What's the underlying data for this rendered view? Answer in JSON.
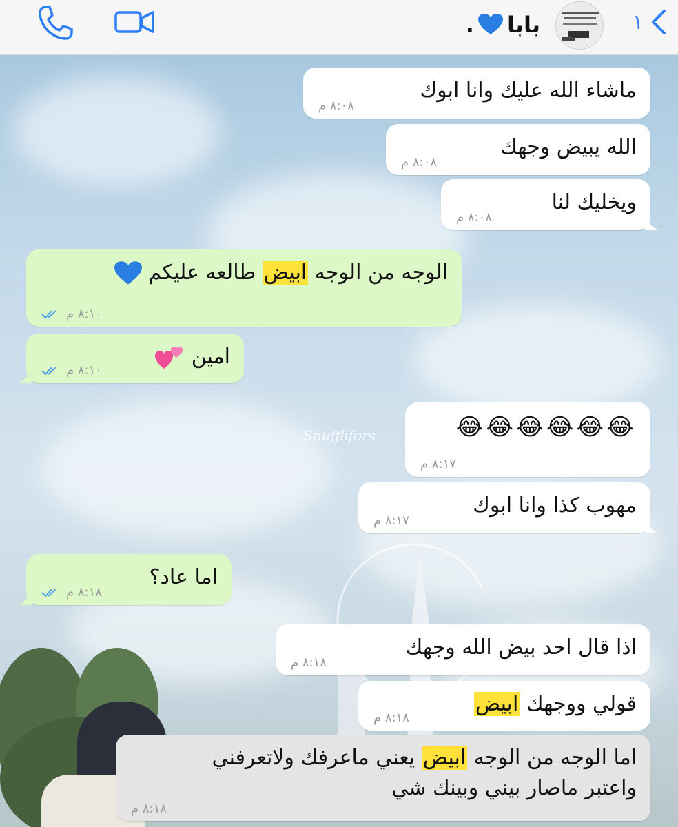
{
  "header": {
    "back_count": "١",
    "contact_name": "بابا",
    "contact_suffix": ".",
    "accent_color": "#2f7ff6"
  },
  "watermark": "Snufflifors",
  "messages": [
    {
      "direction": "in",
      "text": "ماشاء الله عليك وانا ابوك",
      "time": "٨:٠٨ م"
    },
    {
      "direction": "in",
      "text": "الله يبيض وجهك",
      "time": "٨:٠٨ م"
    },
    {
      "direction": "in",
      "text": "ويخليك لنا",
      "time": "٨:٠٨ م"
    },
    {
      "direction": "out",
      "text_before": "الوجه من الوجه ",
      "text_highlight": "ابيض",
      "text_after": " طالعه عليكم",
      "time": "٨:١٠ م",
      "status": "read"
    },
    {
      "direction": "out",
      "text": "امين",
      "time": "٨:١٠ م",
      "status": "read"
    },
    {
      "direction": "in",
      "text": "😂😂😂😂😂😂",
      "time": "٨:١٧ م"
    },
    {
      "direction": "in",
      "text": "مهوب كذا وانا ابوك",
      "time": "٨:١٧ م"
    },
    {
      "direction": "out",
      "text": "اما عاد؟",
      "time": "٨:١٨ م",
      "status": "read"
    },
    {
      "direction": "in",
      "text": "اذا قال احد بيض الله وجهك",
      "time": "٨:١٨ م"
    },
    {
      "direction": "in",
      "text_before": "قولي ووجهك ",
      "text_highlight": "ابيض",
      "text_after": "",
      "time": "٨:١٨ م"
    },
    {
      "direction": "in",
      "text_before": "اما الوجه من الوجه ",
      "text_highlight": "ابيض",
      "text_after": " يعني ماعرفك ولاتعرفني",
      "text_line2": "واعتبر ماصار بيني وبينك شي",
      "time": "٨:١٨ م"
    }
  ],
  "colors": {
    "incoming_bubble": "#ffffff",
    "outgoing_bubble": "#dcf8c6",
    "highlight": "#ffe13a",
    "read_ticks": "#4fa3e8"
  }
}
